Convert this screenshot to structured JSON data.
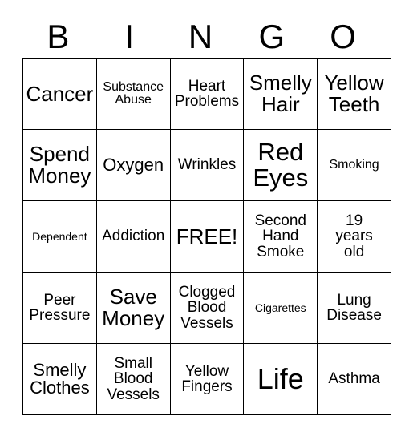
{
  "card": {
    "header_letters": [
      "B",
      "I",
      "N",
      "G",
      "O"
    ],
    "rows": [
      [
        {
          "text": "Cancer",
          "size": "fs-xl"
        },
        {
          "text": "Substance\nAbuse",
          "size": "fs-s"
        },
        {
          "text": "Heart\nProblems",
          "size": "fs-m"
        },
        {
          "text": "Smelly\nHair",
          "size": "fs-xl"
        },
        {
          "text": "Yellow\nTeeth",
          "size": "fs-xl"
        }
      ],
      [
        {
          "text": "Spend\nMoney",
          "size": "fs-xl"
        },
        {
          "text": "Oxygen",
          "size": "fs-l"
        },
        {
          "text": "Wrinkles",
          "size": "fs-m"
        },
        {
          "text": "Red\nEyes",
          "size": "fs-xxl"
        },
        {
          "text": "Smoking",
          "size": "fs-s"
        }
      ],
      [
        {
          "text": "Dependent",
          "size": "fs-xs"
        },
        {
          "text": "Addiction",
          "size": "fs-m"
        },
        {
          "text": "FREE!",
          "size": "fs-xl"
        },
        {
          "text": "Second\nHand\nSmoke",
          "size": "fs-m"
        },
        {
          "text": "19\nyears\nold",
          "size": "fs-m"
        }
      ],
      [
        {
          "text": "Peer\nPressure",
          "size": "fs-m"
        },
        {
          "text": "Save\nMoney",
          "size": "fs-xl"
        },
        {
          "text": "Clogged\nBlood\nVessels",
          "size": "fs-m"
        },
        {
          "text": "Cigarettes",
          "size": "fs-xs"
        },
        {
          "text": "Lung\nDisease",
          "size": "fs-m"
        }
      ],
      [
        {
          "text": "Smelly\nClothes",
          "size": "fs-l"
        },
        {
          "text": "Small\nBlood\nVessels",
          "size": "fs-m"
        },
        {
          "text": "Yellow\nFingers",
          "size": "fs-m"
        },
        {
          "text": "Life",
          "size": "fs-huge"
        },
        {
          "text": "Asthma",
          "size": "fs-m"
        }
      ]
    ]
  },
  "colors": {
    "border": "#000000",
    "background": "#ffffff",
    "text": "#000000"
  }
}
